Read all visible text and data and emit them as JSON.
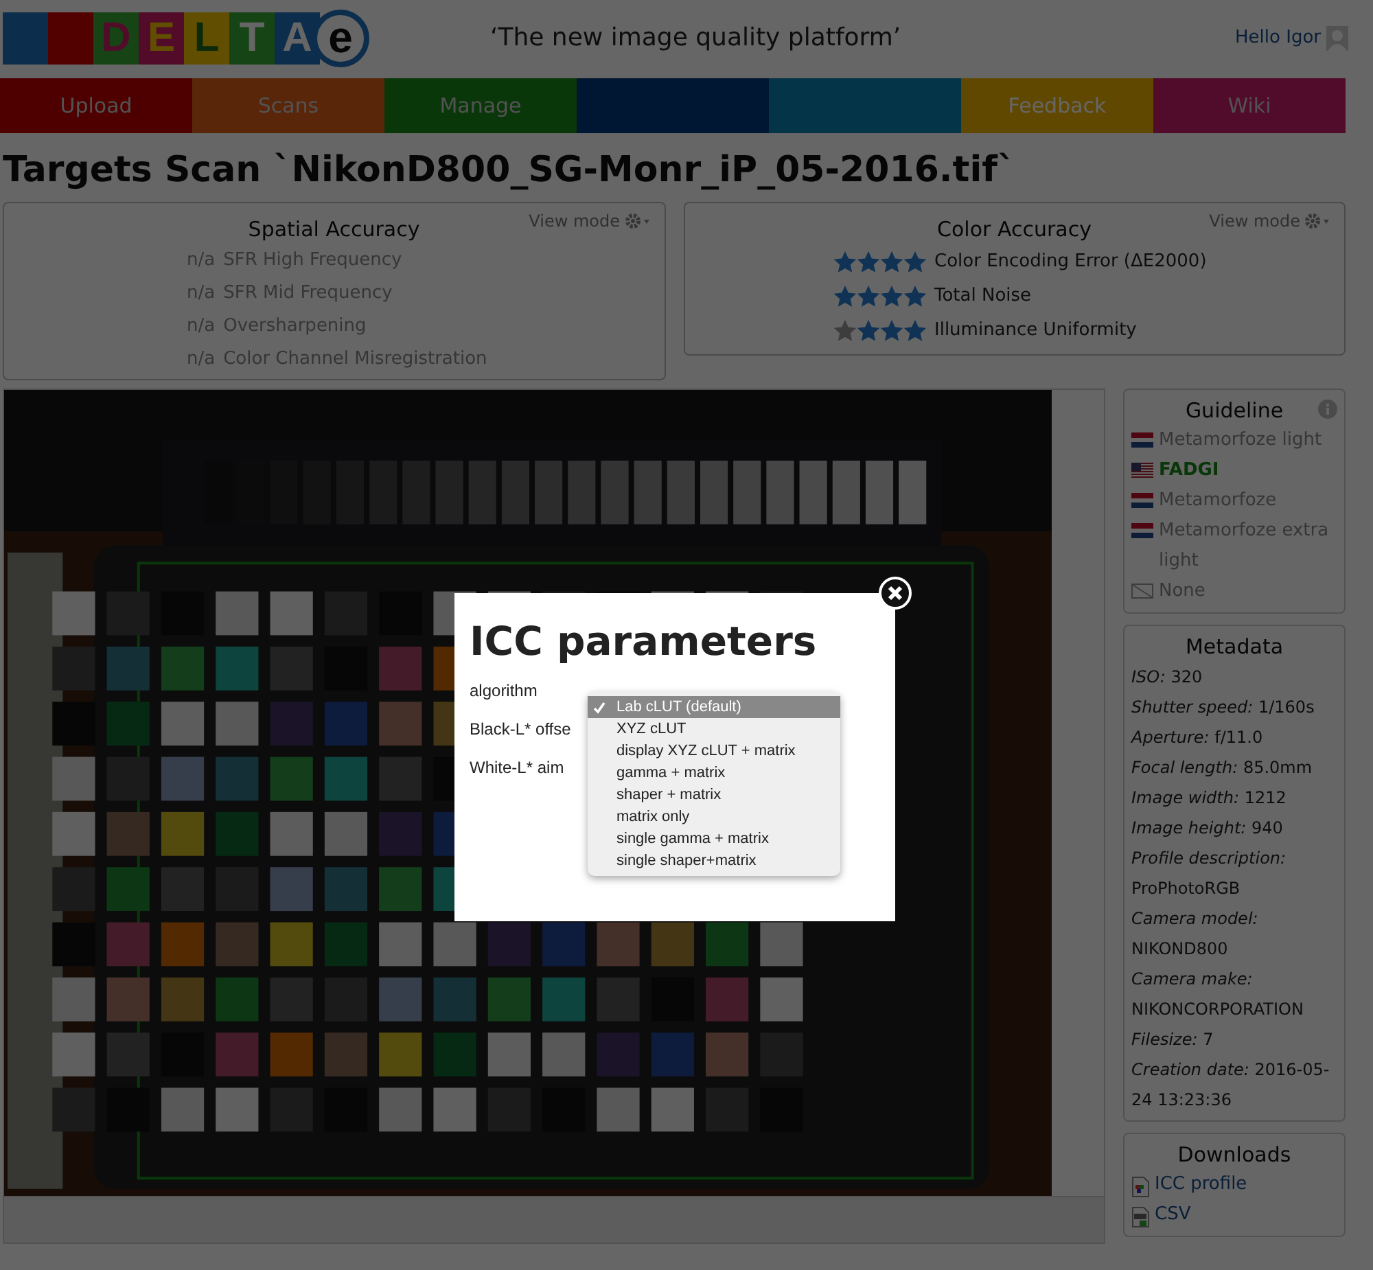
{
  "header": {
    "logo": [
      {
        "kind": "blank"
      },
      {
        "kind": "blank"
      },
      {
        "char": "D",
        "kind": "letter"
      },
      {
        "char": "E",
        "kind": "letter"
      },
      {
        "char": "L",
        "kind": "letter"
      },
      {
        "char": "T",
        "kind": "letter"
      },
      {
        "char": "A",
        "kind": "letter"
      },
      {
        "char": "e",
        "kind": "circle"
      }
    ],
    "tagline": "‘The new image quality platform’",
    "greeting": "Hello Igor"
  },
  "nav": [
    {
      "label": "Upload",
      "kind": "link"
    },
    {
      "label": "Scans",
      "kind": "link"
    },
    {
      "label": "Manage",
      "kind": "link"
    },
    {
      "kind": "blank"
    },
    {
      "kind": "blank"
    },
    {
      "label": "Feedback",
      "kind": "link"
    },
    {
      "label": "Wiki",
      "kind": "link"
    }
  ],
  "page_title": "Targets Scan `NikonD800_SG-Monr_iP_05-2016.tif`",
  "spatial_accuracy": {
    "title": "Spatial Accuracy",
    "view_mode": "View mode",
    "rows": [
      {
        "score": "n/a",
        "label": "SFR High Frequency"
      },
      {
        "score": "n/a",
        "label": "SFR Mid Frequency"
      },
      {
        "score": "n/a",
        "label": "Oversharpening"
      },
      {
        "score": "n/a",
        "label": "Color Channel Misregistration"
      }
    ]
  },
  "color_accuracy": {
    "title": "Color Accuracy",
    "view_mode": "View mode",
    "rows": [
      {
        "stars": 4,
        "label": "Color Encoding Error (ΔE2000)"
      },
      {
        "stars": 4,
        "label": "Total Noise"
      },
      {
        "stars": 3,
        "label": "Illuminance Uniformity"
      }
    ]
  },
  "guideline": {
    "title": "Guideline",
    "items": [
      {
        "label": "Metamorfoze light",
        "kind": "nl",
        "selected": false
      },
      {
        "label": "FADGI",
        "kind": "us",
        "selected": true
      },
      {
        "label": "Metamorfoze",
        "kind": "nl",
        "selected": false
      },
      {
        "label": "Metamorfoze extra light",
        "kind": "nl",
        "selected": false
      },
      {
        "label": "None",
        "kind": "none",
        "selected": false
      }
    ]
  },
  "metadata": {
    "title": "Metadata",
    "fields": [
      {
        "label": "ISO:",
        "value": "320"
      },
      {
        "label": "Shutter speed:",
        "value": "1/160s"
      },
      {
        "label": "Aperture:",
        "value": "f/11.0"
      },
      {
        "label": "Focal length:",
        "value": "85.0mm"
      },
      {
        "label": "Image width:",
        "value": "1212"
      },
      {
        "label": "Image height:",
        "value": "940"
      },
      {
        "label": "Profile description:",
        "value": "ProPhotoRGB"
      },
      {
        "label": "Camera model:",
        "value": "NIKOND800"
      },
      {
        "label": "Camera make:",
        "value": "NIKONCORPORATION"
      },
      {
        "label": "Filesize:",
        "value": "7"
      },
      {
        "label": "Creation date:",
        "value": "2016-05-24 13:23:36"
      }
    ]
  },
  "downloads": {
    "title": "Downloads",
    "items": [
      {
        "label": "ICC profile",
        "kind": "icc"
      },
      {
        "label": "CSV",
        "kind": "csv"
      }
    ]
  },
  "modal": {
    "title": "ICC parameters",
    "fields": [
      {
        "label": "algorithm"
      },
      {
        "label": "Black-L* offse"
      },
      {
        "label": "White-L* aim"
      }
    ],
    "options": [
      {
        "label": "Lab cLUT (default)",
        "selected": true
      },
      {
        "label": "XYZ cLUT",
        "selected": false
      },
      {
        "label": "display XYZ cLUT + matrix",
        "selected": false
      },
      {
        "label": "gamma + matrix",
        "selected": false
      },
      {
        "label": "shaper + matrix",
        "selected": false
      },
      {
        "label": "matrix only",
        "selected": false
      },
      {
        "label": "single gamma + matrix",
        "selected": false
      },
      {
        "label": "single shaper+matrix",
        "selected": false
      }
    ]
  }
}
